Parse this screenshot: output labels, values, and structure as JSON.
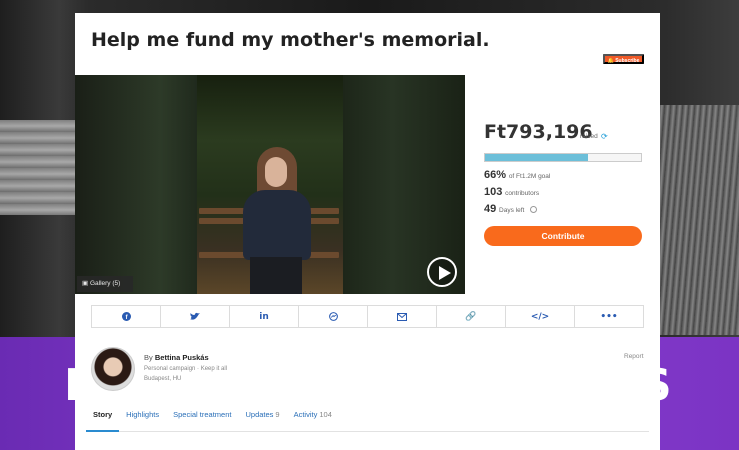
{
  "campaign": {
    "title": "Help me fund my mother's memorial.",
    "subscribe_label": "Subscribe"
  },
  "media": {
    "gallery_label": "Gallery (5)"
  },
  "funding": {
    "amount_raised": "Ft793,196",
    "raised_label": "raised",
    "progress_percent": 66,
    "percent_text": "66%",
    "goal_text": "of Ft1.2M goal",
    "contributors_count": "103",
    "contributors_label": "contributors",
    "days_left": "49",
    "days_left_label": "Days left",
    "contribute_label": "Contribute"
  },
  "share": {
    "icons": [
      "facebook-icon",
      "twitter-icon",
      "linkedin-icon",
      "messenger-icon",
      "email-icon",
      "link-icon",
      "embed-icon",
      "more-icon"
    ]
  },
  "author": {
    "by_prefix": "By",
    "name": "Bettina Puskás",
    "campaign_type": "Personal campaign · Keep it all",
    "location": "Budapest, HU",
    "report_label": "Report"
  },
  "tabs": [
    {
      "label": "Story",
      "count": ""
    },
    {
      "label": "Highlights",
      "count": ""
    },
    {
      "label": "Special treatment",
      "count": ""
    },
    {
      "label": "Updates",
      "count": "9"
    },
    {
      "label": "Activity",
      "count": "104"
    }
  ],
  "background": {
    "letter_left": "I",
    "letter_right": "S"
  },
  "colors": {
    "accent": "#f96a1c",
    "progress": "#6cbfd9",
    "link": "#2a5bb2",
    "purple": "#7b34c4"
  }
}
